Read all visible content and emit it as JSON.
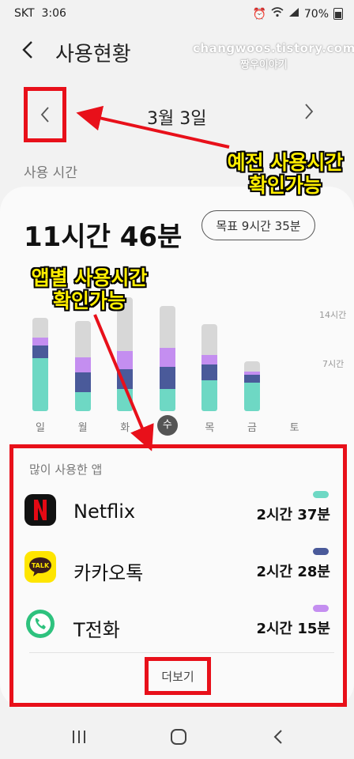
{
  "status": {
    "carrier": "SKT",
    "time": "3:06",
    "battery": "70%"
  },
  "header": {
    "back_icon": "chevron-left-icon",
    "title": "사용현황"
  },
  "watermark": {
    "line1": "changwoos.tistory.com",
    "line2": "짱우이야기"
  },
  "date_nav": {
    "prev_icon": "chevron-left-icon",
    "date": "3월 3일",
    "next_icon": "chevron-right-icon"
  },
  "section_label": "사용 시간",
  "callouts": {
    "date": [
      "예전 사용시간",
      "확인가능"
    ],
    "apps": [
      "앱별 사용시간",
      "확인가능"
    ]
  },
  "summary": {
    "total": "11시간 46분",
    "goal": "목표 9시간 35분"
  },
  "chart_data": {
    "type": "bar",
    "stacked": true,
    "categories": [
      "일",
      "월",
      "화",
      "수",
      "목",
      "금",
      "토"
    ],
    "highlighted_category": "수",
    "gridline_labels": [
      "14시간",
      "7시간"
    ],
    "series": [
      {
        "name": "Netflix",
        "color": "#6ed8c4",
        "values": [
          7.8,
          2.8,
          3.2,
          3.3,
          4.5,
          4.2,
          0
        ]
      },
      {
        "name": "카카오톡",
        "color": "#4a5a9a",
        "values": [
          1.9,
          2.9,
          3.0,
          3.2,
          2.4,
          1.1,
          0
        ]
      },
      {
        "name": "T전화",
        "color": "#c48ef0",
        "values": [
          1.1,
          2.2,
          2.6,
          2.8,
          1.3,
          0.5,
          0
        ]
      },
      {
        "name": "기타",
        "color": "#d7d7d7",
        "values": [
          2.9,
          5.3,
          8.0,
          6.2,
          4.6,
          1.5,
          0
        ]
      }
    ]
  },
  "apps": {
    "header": "많이 사용한 앱",
    "items": [
      {
        "name": "Netflix",
        "time": "2시간 37분",
        "color": "#6ed8c4",
        "icon": "netflix-icon"
      },
      {
        "name": "카카오톡",
        "time": "2시간 28분",
        "color": "#4a5a9a",
        "icon": "kakaotalk-icon"
      },
      {
        "name": "T전화",
        "time": "2시간 15분",
        "color": "#c48ef0",
        "icon": "phone-icon"
      }
    ],
    "more_label": "더보기"
  },
  "nav": {
    "recent_icon": "recent-apps-icon",
    "home_icon": "home-icon",
    "back_icon": "back-icon"
  }
}
